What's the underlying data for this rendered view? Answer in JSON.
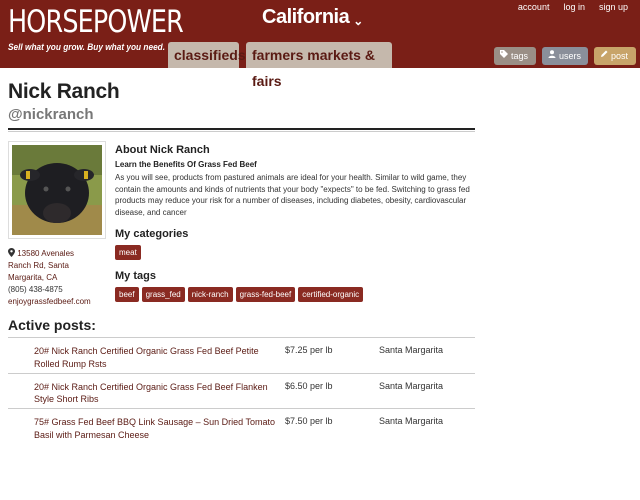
{
  "header": {
    "logo": "HORSEPOWER",
    "tagline": "Sell what you grow. Buy what you need.",
    "region": "California",
    "region_chevron": "⌄",
    "links": {
      "account": "account",
      "login": "log in",
      "signup": "sign up"
    },
    "tabs": {
      "classifieds": "classifieds",
      "markets": "farmers markets & fairs"
    },
    "buttons": {
      "tags": "tags",
      "users": "users",
      "post": "post"
    }
  },
  "profile": {
    "name": "Nick Ranch",
    "handle": "@nickranch",
    "address": {
      "street": "13580 Avenales",
      "road": "Ranch Rd, Santa",
      "city": "Margarita, CA",
      "phone": "(805) 438-4875",
      "website": "enjoygrassfedbeef.com"
    },
    "about_title": "About Nick Ranch",
    "about_subtitle": "Learn the Benefits Of Grass Fed Beef",
    "about_body": "As you will see, products from pastured animals are ideal for your health. Similar to wild game, they contain the amounts and kinds of nutrients that your body \"expects\" to be fed. Switching to grass fed products may reduce your risk for a number of diseases, including diabetes, obesity, cardiovascular disease, and cancer",
    "categories_title": "My categories",
    "categories": [
      "meat"
    ],
    "tags_title": "My tags",
    "tags": [
      "beef",
      "grass_fed",
      "nick-ranch",
      "grass-fed-beef",
      "certified-organic"
    ]
  },
  "posts": {
    "title": "Active posts:",
    "items": [
      {
        "title": "20# Nick Ranch Certified Organic Grass Fed Beef Petite Rolled Rump Rsts",
        "price": "$7.25 per lb",
        "location": "Santa Margarita"
      },
      {
        "title": "20# Nick Ranch Certified Organic Grass Fed Beef Flanken Style Short Ribs",
        "price": "$6.50 per lb",
        "location": "Santa Margarita"
      },
      {
        "title": "75# Grass Fed Beef BBQ Link Sausage – Sun Dried Tomato Basil with Parmesan Cheese",
        "price": "$7.50 per lb",
        "location": "Santa Margarita"
      }
    ]
  },
  "colors": {
    "header": "#7a1f17",
    "chip": "#8a2a22",
    "link": "#5a1a13",
    "tab": "#c5b8ac"
  }
}
